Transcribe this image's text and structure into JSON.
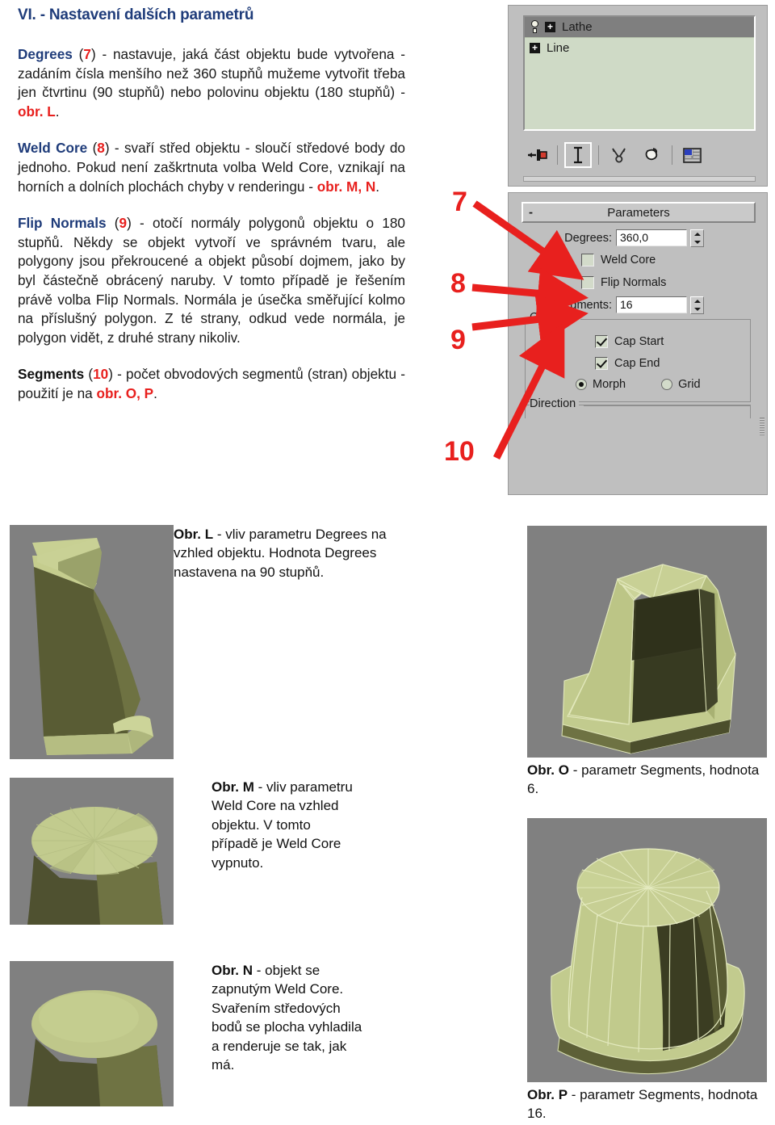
{
  "document": {
    "heading": "VI. - Nastavení dalších parametrů"
  },
  "paragraphs": {
    "degrees": {
      "term": "Degrees",
      "number": "7",
      "body_1": ") - nastavuje, jaká část objektu bude vytvořena - zadáním čísla menšího než 360 stupňů mužeme vytvořit třeba jen čtvrtinu (90 stupňů) nebo polovinu objektu (180 stupňů) - ",
      "ref": "obr. L",
      "body_2": "."
    },
    "weld_core": {
      "term": "Weld Core",
      "number": "8",
      "body_1": ") - svaří střed objektu - sloučí středové body do jednoho. Pokud není zaškrtnuta volba Weld Core, vznikají na horních a dolních plochách chyby v renderingu - ",
      "ref": "obr. M, N",
      "body_2": "."
    },
    "flip_normals": {
      "term": "Flip Normals",
      "number": "9",
      "body_1": ") - otočí normály polygonů objektu o 180 stupňů. Někdy se objekt vytvoří ve správném tvaru, ale polygony jsou překroucené a objekt působí dojmem, jako by byl částečně obrácený naruby. V tomto případě je řešením právě volba Flip Normals. Normála je úsečka směřující kolmo na příslušný polygon. Z té strany, odkud vede normála, je polygon vidět, z druhé strany nikoliv.",
      "ref": "",
      "body_2": ""
    },
    "segments": {
      "term": "Segments",
      "number": "10",
      "body_1": ") - počet obvodových segmentů (stran) objektu - použití je na ",
      "ref": "obr. O, P",
      "body_2": "."
    }
  },
  "max_panel": {
    "stack": {
      "rows": [
        {
          "label": "Lathe",
          "icon": "lightbulb-icon",
          "expander": "+",
          "selected": true
        },
        {
          "label": "Line",
          "icon": "",
          "expander": "+",
          "selected": false
        }
      ],
      "toolbar": [
        {
          "name": "pin-stack-icon",
          "active": false
        },
        {
          "name": "show-end-result-icon",
          "active": true
        },
        {
          "name": "make-unique-icon",
          "active": false
        },
        {
          "name": "remove-modifier-icon",
          "active": false
        },
        {
          "name": "configure-modifier-sets-icon",
          "active": false
        }
      ]
    },
    "parameters": {
      "rollout_title": "Parameters",
      "rollout_toggle": "-",
      "degrees_label": "Degrees:",
      "degrees_value": "360,0",
      "weld_core_label": "Weld Core",
      "weld_core_checked": false,
      "flip_normals_label": "Flip Normals",
      "flip_normals_checked": false,
      "segments_label": "Segments:",
      "segments_value": "16",
      "capping_group": "Capping",
      "cap_start_label": "Cap Start",
      "cap_start_checked": true,
      "cap_end_label": "Cap End",
      "cap_end_checked": true,
      "morph_label": "Morph",
      "morph_selected": true,
      "grid_label": "Grid",
      "grid_selected": false,
      "direction_group": "Direction"
    }
  },
  "callouts": [
    {
      "label": "7",
      "target": "degrees-field"
    },
    {
      "label": "8",
      "target": "weld-core-checkbox"
    },
    {
      "label": "9",
      "target": "flip-normals-checkbox"
    },
    {
      "label": "10",
      "target": "segments-field"
    }
  ],
  "figures": {
    "L": {
      "caption_bold": "Obr. L",
      "caption_rest": " - vliv parametru Degrees na vzhled objektu. Hodnota Degrees nastavena na 90 stupňů."
    },
    "M": {
      "caption_bold": "Obr. M",
      "caption_rest": " - vliv parametru Weld Core na vzhled objektu. V tomto případě je  Weld Core vypnuto."
    },
    "N": {
      "caption_bold": "Obr. N",
      "caption_rest": " - objekt se zapnutým Weld Core. Svařením středových bodů se plocha vyhladila  a renderuje se tak, jak má."
    },
    "O": {
      "caption_bold": "Obr. O",
      "caption_rest": " - parametr Segments, hodnota 6."
    },
    "P": {
      "caption_bold": "Obr. P",
      "caption_rest": " - parametr Segments, hodnota 16."
    }
  },
  "colors": {
    "heading_blue": "#1f3c7a",
    "accent_red": "#e8201e",
    "panel_gray": "#bfbfbf",
    "stack_green": "#cfdac6",
    "render_bg": "#808080",
    "model_light": "#c2cb8e",
    "model_dark": "#4d4f2c"
  }
}
